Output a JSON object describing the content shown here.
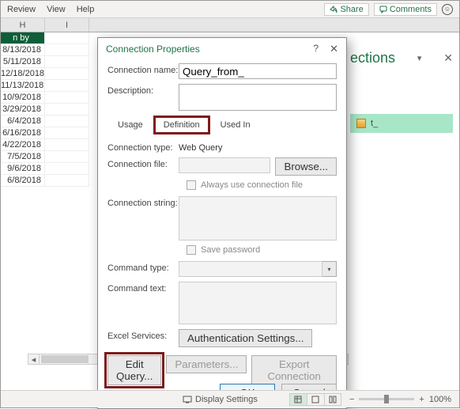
{
  "ribbon": {
    "tabs": [
      "Review",
      "View",
      "Help"
    ],
    "share": "Share",
    "comments": "Comments"
  },
  "columns": {
    "H": "H",
    "I": "I"
  },
  "gridHeader": "n by",
  "dates": [
    "8/13/2018",
    "5/11/2018",
    "12/18/2018",
    "11/13/2018",
    "10/9/2018",
    "3/29/2018",
    "6/4/2018",
    "6/16/2018",
    "4/22/2018",
    "7/5/2018",
    "9/6/2018",
    "6/8/2018"
  ],
  "pane": {
    "title": "ections",
    "item": "t_"
  },
  "dialog": {
    "title": "Connection Properties",
    "help": "?",
    "labels": {
      "name": "Connection name:",
      "desc": "Description:",
      "type": "Connection type:",
      "file": "Connection file:",
      "cstring": "Connection string:",
      "cmdtype": "Command type:",
      "cmdtext": "Command text:",
      "excelsvc": "Excel Services:"
    },
    "name_value": "Query_from_",
    "tabs": {
      "usage": "Usage",
      "def": "Definition",
      "used": "Used In"
    },
    "type_value": "Web Query",
    "browse": "Browse...",
    "always": "Always use connection file",
    "savepw": "Save password",
    "auth": "Authentication Settings...",
    "edit": "Edit Query...",
    "params": "Parameters...",
    "export": "Export Connection File...",
    "ok": "OK",
    "cancel": "Cancel"
  },
  "status": {
    "display": "Display Settings",
    "zoom": "100%",
    "minus": "−",
    "plus": "+"
  }
}
